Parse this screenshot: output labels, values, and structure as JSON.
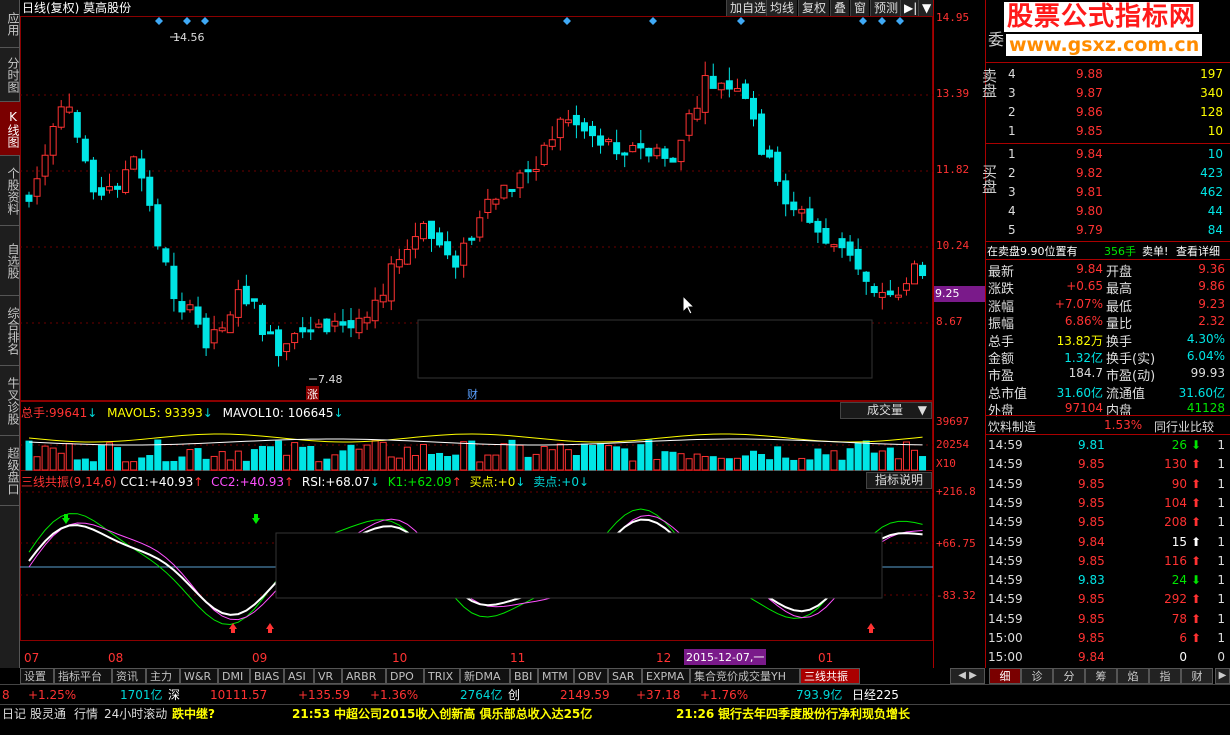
{
  "left_nav": [
    {
      "label": "应用"
    },
    {
      "label": "分时图"
    },
    {
      "label": "K线图",
      "active": true
    },
    {
      "label": "个股资料"
    },
    {
      "label": "自选股"
    },
    {
      "label": "综合排名"
    },
    {
      "label": "牛叉诊股"
    },
    {
      "label": "超级盘口"
    }
  ],
  "chart_header": {
    "title": "日线(复权) 莫高股份"
  },
  "toolbar": {
    "add_watch": "加自选",
    "ma_line": "均线",
    "restore": "复权",
    "overlay": "叠",
    "window": "窗",
    "forecast": "预测"
  },
  "watermark": {
    "title": "股票公式指标网",
    "url": "www.gsxz.com.cn"
  },
  "price_axis": {
    "labels": [
      "14.95",
      "13.39",
      "11.82",
      "10.24",
      "8.67"
    ],
    "current": "9.25"
  },
  "vol_axis": {
    "labels": [
      "39697",
      "20254",
      "X10"
    ]
  },
  "ind_axis": {
    "labels": [
      "+216.8",
      "+66.75",
      "-83.32"
    ]
  },
  "date_axis": {
    "labels": [
      "07",
      "08",
      "09",
      "10",
      "11",
      "12",
      "01"
    ],
    "highlight": "2015-12-07,一"
  },
  "chart_labels": {
    "high": "14.56",
    "low": "7.48",
    "zhang": "涨",
    "cai": "财"
  },
  "volume_header": {
    "total_label": "总手:",
    "total_value": "99641",
    "mavol5_label": "MAVOL5:",
    "mavol5_value": "93393",
    "mavol10_label": "MAVOL10:",
    "mavol10_value": "106645",
    "dropdown": "成交量"
  },
  "indicator_header": {
    "name": "三线共振(9,14,6)",
    "cc1_label": "CC1:",
    "cc1_value": "+40.93",
    "cc2_label": "CC2:",
    "cc2_value": "+40.93",
    "rsi_label": "RSI:",
    "rsi_value": "+68.07",
    "k1_label": "K1:",
    "k1_value": "+62.09",
    "buy_label": "买点:",
    "buy_value": "+0",
    "sell_label": "卖点:",
    "sell_value": "+0",
    "help": "指标说明"
  },
  "order_book": {
    "ratio_label": "委",
    "sell_label": "卖盘",
    "buy_label": "买盘",
    "sell": [
      {
        "level": "4",
        "price": "9.88",
        "vol": "197"
      },
      {
        "level": "3",
        "price": "9.87",
        "vol": "340"
      },
      {
        "level": "2",
        "price": "9.86",
        "vol": "128"
      },
      {
        "level": "1",
        "price": "9.85",
        "vol": "10"
      }
    ],
    "buy": [
      {
        "level": "1",
        "price": "9.84",
        "vol": "10"
      },
      {
        "level": "2",
        "price": "9.82",
        "vol": "423"
      },
      {
        "level": "3",
        "price": "9.81",
        "vol": "462"
      },
      {
        "level": "4",
        "price": "9.80",
        "vol": "44"
      },
      {
        "level": "5",
        "price": "9.79",
        "vol": "84"
      }
    ]
  },
  "notice": {
    "text": "在卖盘9.90位置有",
    "vol": "356手",
    "action": "卖单!",
    "detail": "查看详细"
  },
  "quote": [
    {
      "l1": "最新",
      "v1": "9.84",
      "l2": "开盘",
      "v2": "9.36"
    },
    {
      "l1": "涨跌",
      "v1": "+0.65",
      "l2": "最高",
      "v2": "9.86"
    },
    {
      "l1": "涨幅",
      "v1": "+7.07%",
      "l2": "最低",
      "v2": "9.23"
    },
    {
      "l1": "振幅",
      "v1": "6.86%",
      "l2": "量比",
      "v2": "2.32"
    },
    {
      "l1": "总手",
      "v1": "13.82万",
      "l2": "换手",
      "v2": "4.30%"
    },
    {
      "l1": "金额",
      "v1": "1.32亿",
      "l2": "换手(实)",
      "v2": "6.04%"
    },
    {
      "l1": "市盈",
      "v1": "184.7",
      "l2": "市盈(动)",
      "v2": "99.93"
    },
    {
      "l1": "总市值",
      "v1": "31.60亿",
      "l2": "流通值",
      "v2": "31.60亿"
    },
    {
      "l1": "外盘",
      "v1": "97104",
      "l2": "内盘",
      "v2": "41128"
    }
  ],
  "industry": {
    "name": "饮料制造",
    "pct": "1.53%",
    "compare": "同行业比较"
  },
  "ticks": [
    {
      "t": "14:59",
      "p": "9.81",
      "v": "26",
      "d": "down",
      "n": "1"
    },
    {
      "t": "14:59",
      "p": "9.85",
      "v": "130",
      "d": "up",
      "n": "1"
    },
    {
      "t": "14:59",
      "p": "9.85",
      "v": "90",
      "d": "up",
      "n": "1"
    },
    {
      "t": "14:59",
      "p": "9.85",
      "v": "104",
      "d": "up",
      "n": "1"
    },
    {
      "t": "14:59",
      "p": "9.85",
      "v": "208",
      "d": "up",
      "n": "1"
    },
    {
      "t": "14:59",
      "p": "9.84",
      "v": "15",
      "d": "white",
      "n": "1"
    },
    {
      "t": "14:59",
      "p": "9.85",
      "v": "116",
      "d": "up",
      "n": "1"
    },
    {
      "t": "14:59",
      "p": "9.83",
      "v": "24",
      "d": "down",
      "n": "1"
    },
    {
      "t": "14:59",
      "p": "9.85",
      "v": "292",
      "d": "up",
      "n": "1"
    },
    {
      "t": "14:59",
      "p": "9.85",
      "v": "78",
      "d": "up",
      "n": "1"
    },
    {
      "t": "15:00",
      "p": "9.85",
      "v": "6",
      "d": "up",
      "n": "1"
    },
    {
      "t": "15:00",
      "p": "9.84",
      "v": "0",
      "d": "none",
      "n": "0"
    }
  ],
  "bottom_tabs": [
    "设置",
    "指标平台",
    "资讯",
    "主力",
    "W&R",
    "DMI",
    "BIAS",
    "ASI",
    "VR",
    "ARBR",
    "DPO",
    "TRIX",
    "新DMA",
    "BBI",
    "MTM",
    "OBV",
    "SAR",
    "EXPMA",
    "集合竞价成交量YH",
    "三线共振"
  ],
  "right_tabs": [
    "细",
    "诊",
    "分",
    "筹",
    "焰",
    "指",
    "财"
  ],
  "ticker": {
    "a": "8",
    "b": "+1.25%",
    "c": "1701亿",
    "d": "深",
    "e": "10111.57",
    "f": "+135.59",
    "g": "+1.36%",
    "h": "2764亿",
    "i": "创",
    "j": "2149.59",
    "k": "+37.18",
    "l": "+1.76%",
    "m": "793.9亿",
    "n": "日经225"
  },
  "news": {
    "n1": "日记",
    "n2": "股灵通",
    "n3": "行情",
    "n4": "24小时滚动",
    "h1": "跌中继?",
    "t2": "21:53",
    "h2": "中超公司2015收入创新高 俱乐部总收入达25亿",
    "t3": "21:26",
    "h3": "银行去年四季度股份行净利现负增长"
  },
  "colors": {
    "up": "#ff3232",
    "down": "#00e5e5",
    "grid": "#8b0000"
  }
}
